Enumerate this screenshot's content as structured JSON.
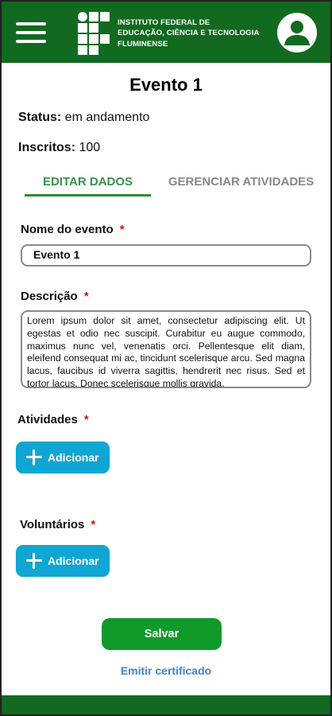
{
  "header": {
    "institution_lines": [
      "INSTITUTO FEDERAL DE",
      "EDUCAÇÃO, CIÊNCIA E TECNOLOGIA",
      "FLUMINENSE"
    ],
    "brand_color": "#116a1f",
    "menu_icon": "hamburger-menu-icon",
    "profile_icon": "user-avatar-icon"
  },
  "event": {
    "title": "Evento 1",
    "status_label": "Status:",
    "status_value": " em andamento",
    "enrolled_label": "Inscritos:",
    "enrolled_value": " 100"
  },
  "tabs": [
    {
      "label": "EDITAR DADOS",
      "active": true
    },
    {
      "label": "GERENCIAR ATIVIDADES",
      "active": false
    }
  ],
  "form": {
    "name_label": "Nome do evento",
    "name_value": "Evento 1",
    "description_label": "Descrição",
    "description_value": "Lorem ipsum dolor sit amet, consectetur adipiscing elit. Ut egestas et odio nec suscipit. Curabitur eu augue commodo, maximus nunc vel, venenatis orci. Pellentesque elit diam, eleifend consequat mi ac, tincidunt scelerisque arcu. Sed magna lacus, faucibus id viverra sagittis, hendrerit nec risus. Sed et tortor lacus. Donec scelerisque mollis gravida.",
    "required_mark": "*",
    "activities_label": "Atividades",
    "volunteers_label": "Voluntários",
    "add_label": "Adicionar"
  },
  "actions": {
    "save_label": "Salvar",
    "certificate_label": "Emitir certificado"
  },
  "colors": {
    "accent_green": "#0f9a2a",
    "tab_active": "#3a8f4c",
    "add_button": "#0fa6d3",
    "link": "#3b84d6",
    "required": "#d01515"
  }
}
